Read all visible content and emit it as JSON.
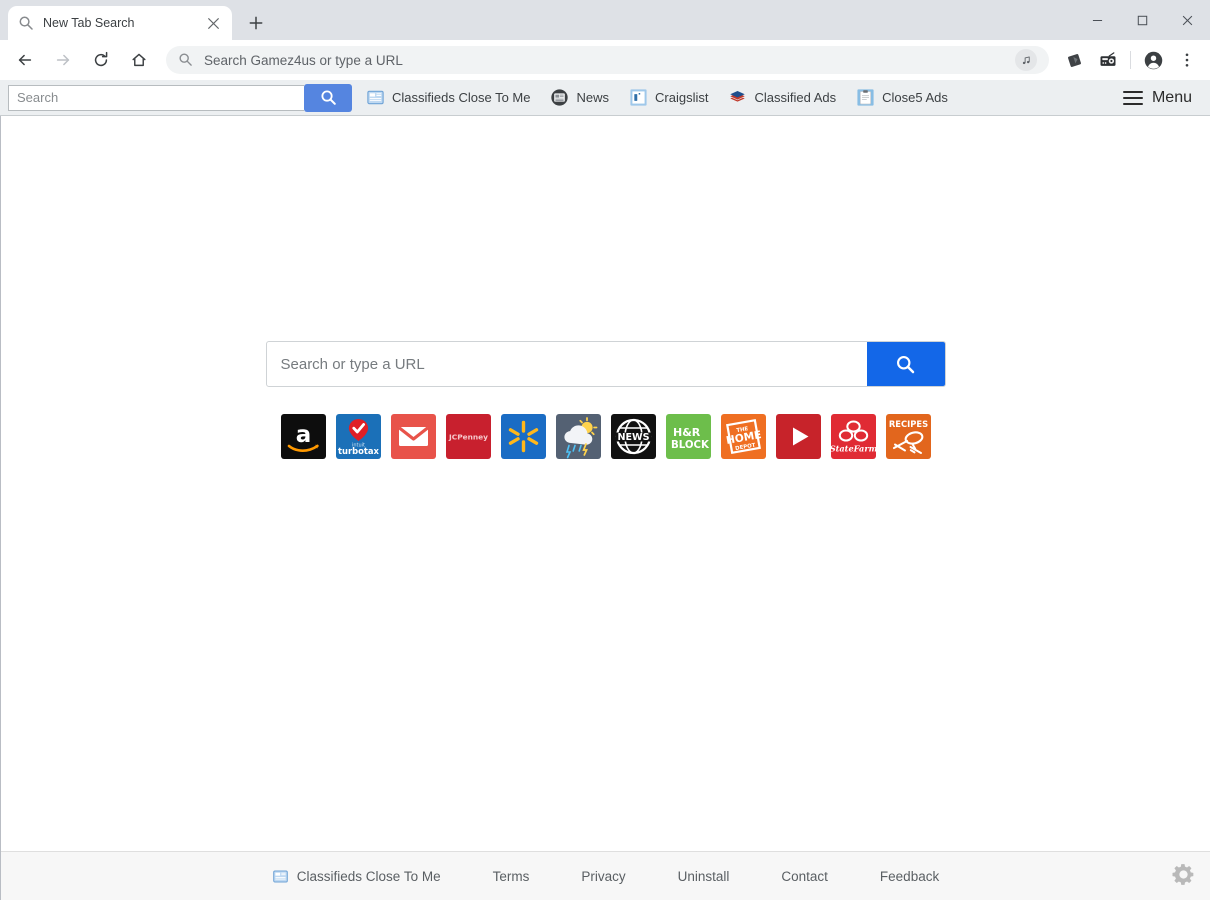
{
  "window": {
    "minimize_label": "Minimize",
    "maximize_label": "Maximize",
    "close_label": "Close"
  },
  "tab": {
    "title": "New Tab Search",
    "favicon": "search-icon",
    "close_label": "Close tab",
    "new_tab_label": "New tab"
  },
  "omnibox": {
    "placeholder": "Search Gamez4us or type a URL",
    "value": "",
    "search_icon": "search-icon",
    "media_icon": "music-note-icon"
  },
  "nav": {
    "back": "Back",
    "forward": "Forward",
    "reload": "Reload",
    "home": "Home"
  },
  "browser_actions": [
    {
      "name": "extension-diamond-icon",
      "label": "Extension"
    },
    {
      "name": "radio-icon",
      "label": "Radio"
    },
    {
      "name": "profile-icon",
      "label": "Profile"
    },
    {
      "name": "chrome-menu-icon",
      "label": "Customize and control"
    }
  ],
  "extbar": {
    "search": {
      "placeholder": "Search",
      "value": ""
    },
    "search_button_icon": "search-icon",
    "search_button_color": "#5585e0",
    "links": [
      {
        "label": "Classifieds Close To Me",
        "icon": "newspaper-icon"
      },
      {
        "label": "News",
        "icon": "news-circle-icon"
      },
      {
        "label": "Craigslist",
        "icon": "craigslist-icon"
      },
      {
        "label": "Classified Ads",
        "icon": "layers-icon"
      },
      {
        "label": "Close5 Ads",
        "icon": "clipboard-icon"
      }
    ],
    "menu_label": "Menu",
    "menu_icon": "hamburger-icon"
  },
  "main": {
    "search": {
      "placeholder": "Search or type a URL",
      "value": "",
      "button_icon": "search-icon",
      "button_color": "#1367e8"
    },
    "tiles": [
      {
        "name": "amazon",
        "label": "amazon",
        "bg": "#0d0d0d"
      },
      {
        "name": "turbotax",
        "label": "turbotax",
        "sub": "intuit",
        "bg": "#1b70b8"
      },
      {
        "name": "mail",
        "label": "Mail",
        "bg": "#e8534a"
      },
      {
        "name": "jcpenney",
        "label": "JCPenney",
        "bg": "#c8202e"
      },
      {
        "name": "walmart",
        "label": "Walmart",
        "bg": "#1a6cc4"
      },
      {
        "name": "weather",
        "label": "Weather",
        "bg": "#546173"
      },
      {
        "name": "news",
        "label": "NEWS",
        "bg": "#111111"
      },
      {
        "name": "hr-block",
        "label": "H&R BLOCK",
        "bg": "#6dbe4b"
      },
      {
        "name": "home-depot",
        "label": "THE HOME DEPOT",
        "bg": "#ef6f22"
      },
      {
        "name": "youtube",
        "label": "YouTube",
        "bg": "#c7232a"
      },
      {
        "name": "state-farm",
        "label": "State Farm",
        "bg": "#e02b34"
      },
      {
        "name": "recipes",
        "label": "RECIPES",
        "bg": "#e2661d"
      }
    ]
  },
  "footer": {
    "links": [
      {
        "label": "Classifieds Close To Me",
        "icon": "newspaper-icon"
      },
      {
        "label": "Terms",
        "icon": ""
      },
      {
        "label": "Privacy",
        "icon": ""
      },
      {
        "label": "Uninstall",
        "icon": ""
      },
      {
        "label": "Contact",
        "icon": ""
      },
      {
        "label": "Feedback",
        "icon": ""
      }
    ],
    "settings_icon": "gear-icon"
  }
}
